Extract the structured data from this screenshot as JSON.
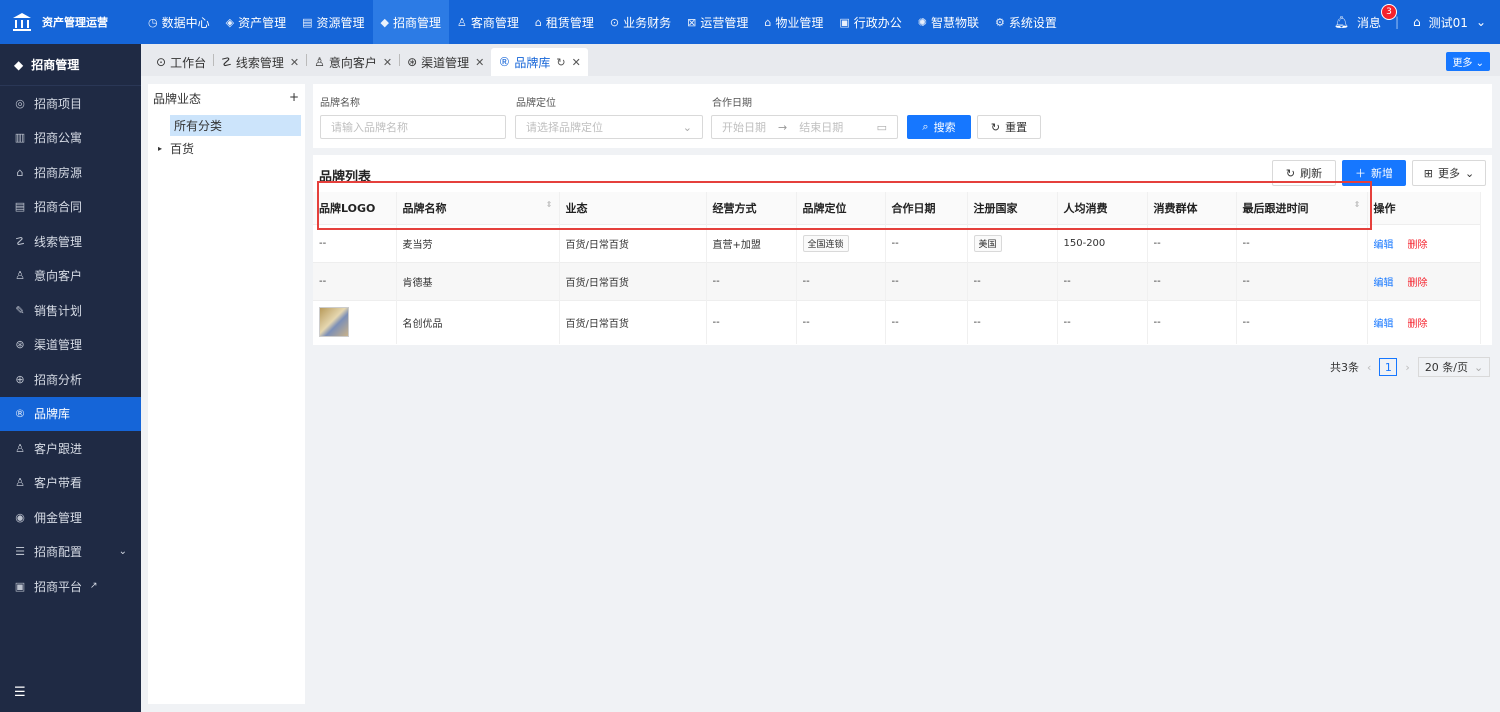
{
  "app": {
    "title": "资产管理运营"
  },
  "topnav": [
    {
      "icon": "dashboard-icon",
      "glyph": "◷",
      "label": "数据中心"
    },
    {
      "icon": "box-icon",
      "glyph": "◈",
      "label": "资产管理"
    },
    {
      "icon": "resource-icon",
      "glyph": "▤",
      "label": "资源管理"
    },
    {
      "icon": "tag-icon",
      "glyph": "◆",
      "label": "招商管理"
    },
    {
      "icon": "customer-icon",
      "glyph": "♙",
      "label": "客商管理"
    },
    {
      "icon": "lease-icon",
      "glyph": "⌂",
      "label": "租赁管理"
    },
    {
      "icon": "finance-icon",
      "glyph": "⊙",
      "label": "业务财务"
    },
    {
      "icon": "ops-icon",
      "glyph": "⊠",
      "label": "运营管理"
    },
    {
      "icon": "property-icon",
      "glyph": "⌂",
      "label": "物业管理"
    },
    {
      "icon": "office-icon",
      "glyph": "▣",
      "label": "行政办公"
    },
    {
      "icon": "iot-icon",
      "glyph": "✺",
      "label": "智慧物联"
    },
    {
      "icon": "settings-icon",
      "glyph": "⚙",
      "label": "系统设置"
    }
  ],
  "user": {
    "messages_label": "消息",
    "messages_count": "3",
    "name": "测试01"
  },
  "sidebar": {
    "header": "招商管理",
    "items": [
      {
        "icon": "project-icon",
        "glyph": "◎",
        "label": "招商项目"
      },
      {
        "icon": "apartment-icon",
        "glyph": "▥",
        "label": "招商公寓"
      },
      {
        "icon": "house-icon",
        "glyph": "⌂",
        "label": "招商房源"
      },
      {
        "icon": "contract-icon",
        "glyph": "▤",
        "label": "招商合同"
      },
      {
        "icon": "clue-icon",
        "glyph": "☡",
        "label": "线索管理"
      },
      {
        "icon": "customer-icon",
        "glyph": "♙",
        "label": "意向客户"
      },
      {
        "icon": "plan-icon",
        "glyph": "✎",
        "label": "销售计划"
      },
      {
        "icon": "channel-icon",
        "glyph": "⊛",
        "label": "渠道管理"
      },
      {
        "icon": "analysis-icon",
        "glyph": "⊕",
        "label": "招商分析"
      },
      {
        "icon": "brand-icon",
        "glyph": "®",
        "label": "品牌库"
      },
      {
        "icon": "follow-icon",
        "glyph": "♙",
        "label": "客户跟进"
      },
      {
        "icon": "visit-icon",
        "glyph": "♙",
        "label": "客户带看"
      },
      {
        "icon": "commission-icon",
        "glyph": "◉",
        "label": "佣金管理"
      },
      {
        "icon": "config-icon",
        "glyph": "☰",
        "label": "招商配置"
      },
      {
        "icon": "platform-icon",
        "glyph": "▣",
        "label": "招商平台"
      }
    ]
  },
  "tabs": [
    {
      "icon": "workbench-icon",
      "glyph": "⊙",
      "label": "工作台"
    },
    {
      "icon": "clue-icon",
      "glyph": "☡",
      "label": "线索管理"
    },
    {
      "icon": "customer-icon",
      "glyph": "♙",
      "label": "意向客户"
    },
    {
      "icon": "channel-icon",
      "glyph": "⊛",
      "label": "渠道管理"
    },
    {
      "icon": "brand-icon",
      "glyph": "®",
      "label": "品牌库"
    }
  ],
  "tabs_more": "更多",
  "tree": {
    "title": "品牌业态",
    "selected": "所有分类",
    "node": "百货"
  },
  "filters": {
    "brand_name_label": "品牌名称",
    "brand_name_placeholder": "请输入品牌名称",
    "position_label": "品牌定位",
    "position_placeholder": "请选择品牌定位",
    "date_label": "合作日期",
    "start_placeholder": "开始日期",
    "end_placeholder": "结束日期",
    "search": "搜索",
    "reset": "重置"
  },
  "list": {
    "title": "品牌列表",
    "refresh": "刷新",
    "add": "新增",
    "more": "更多"
  },
  "table": {
    "columns": [
      "品牌LOGO",
      "品牌名称",
      "业态",
      "经营方式",
      "品牌定位",
      "合作日期",
      "注册国家",
      "人均消费",
      "消费群体",
      "最后跟进时间",
      "操作"
    ],
    "rows": [
      {
        "logo": "--",
        "name": "麦当劳",
        "format": "百货/日常百货",
        "mode": "直营+加盟",
        "position": "全国连锁",
        "date": "--",
        "country": "美国",
        "spend": "150-200",
        "group": "--",
        "last": "--"
      },
      {
        "logo": "--",
        "name": "肯德基",
        "format": "百货/日常百货",
        "mode": "--",
        "position": "--",
        "date": "--",
        "country": "--",
        "spend": "--",
        "group": "--",
        "last": "--"
      },
      {
        "logo": "",
        "name": "名创优品",
        "format": "百货/日常百货",
        "mode": "--",
        "position": "--",
        "date": "--",
        "country": "--",
        "spend": "--",
        "group": "--",
        "last": "--"
      }
    ],
    "edit": "编辑",
    "delete": "删除"
  },
  "pagination": {
    "total": "共3条",
    "current": "1",
    "page_size": "20 条/页"
  }
}
